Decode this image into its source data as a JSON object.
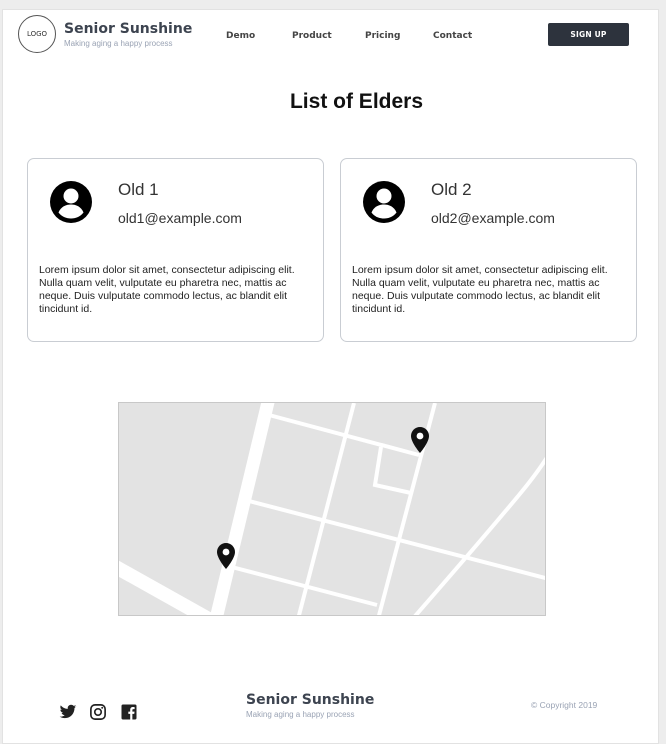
{
  "header": {
    "logo_text": "LOGO",
    "brand_title": "Senior Sunshine",
    "brand_subtitle": "Making aging a happy process",
    "nav": [
      "Demo",
      "Product",
      "Pricing",
      "Contact"
    ],
    "signup_label": "SIGN UP"
  },
  "main": {
    "title": "List of Elders",
    "elders": [
      {
        "name": "Old 1",
        "email": "old1@example.com",
        "description": "Lorem ipsum dolor sit amet, consectetur adipiscing elit. Nulla quam velit, vulputate eu pharetra nec, mattis ac neque. Duis vulputate commodo lectus, ac blandit elit tincidunt id."
      },
      {
        "name": "Old 2",
        "email": "old2@example.com",
        "description": "Lorem ipsum dolor sit amet, consectetur adipiscing elit. Nulla quam velit, vulputate eu pharetra nec, mattis ac neque. Duis vulputate commodo lectus, ac blandit elit tincidunt id."
      }
    ],
    "map": {
      "markers": 2,
      "icon": "map-pin-icon"
    }
  },
  "footer": {
    "social_icons": [
      "twitter-icon",
      "instagram-icon",
      "facebook-icon"
    ],
    "brand_title": "Senior Sunshine",
    "brand_subtitle": "Making aging a happy process",
    "copyright": "© Copyright 2019"
  },
  "colors": {
    "brand_text": "#3d4450",
    "subtitle": "#9aa3b4",
    "button_bg": "#2d333d",
    "map_bg": "#e3e3e3"
  }
}
